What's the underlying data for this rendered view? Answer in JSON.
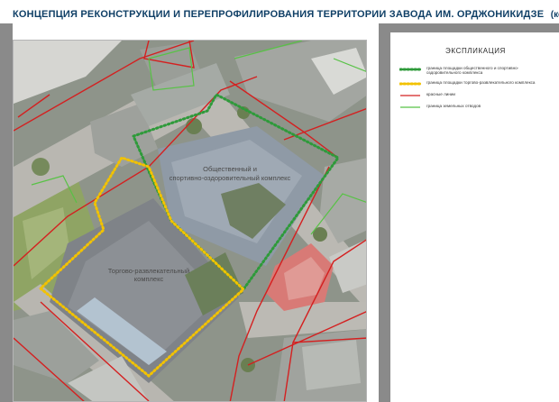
{
  "header": {
    "title": "КОНЦЕПЦИЯ РЕКОНСТРУКЦИИ И ПЕРЕПРОФИЛИРОВАНИЯ ТЕРРИТОРИИ ЗАВОДА ИМ. ОРДЖОНИКИДЗЕ",
    "subtitle": "(корректировка)"
  },
  "legend": {
    "title": "ЭКСПЛИКАЦИЯ",
    "items": [
      {
        "label": "граница площадки общественного и спортивно-оздоровительного комплекса",
        "style": "dotted-green",
        "color": "#2e9a3a"
      },
      {
        "label": "граница площадки торгово-развлекательного комплекса",
        "style": "dotted-yellow",
        "color": "#f2c200"
      },
      {
        "label": "красные линии",
        "style": "line-red",
        "color": "#d42020"
      },
      {
        "label": "граница земельных отводов",
        "style": "line-green",
        "color": "#58c246"
      }
    ]
  },
  "map": {
    "labels": {
      "public_line1": "Общественный и",
      "public_line2": "спортивно-оздоровительный комплекс",
      "trade_line1": "Торгово-развлекательный",
      "trade_line2": "комплекс"
    },
    "colors": {
      "green_boundary": "#2e9a3a",
      "yellow_boundary": "#f2c200",
      "red_lines": "#d42020",
      "land_boundary": "#58c246"
    }
  }
}
